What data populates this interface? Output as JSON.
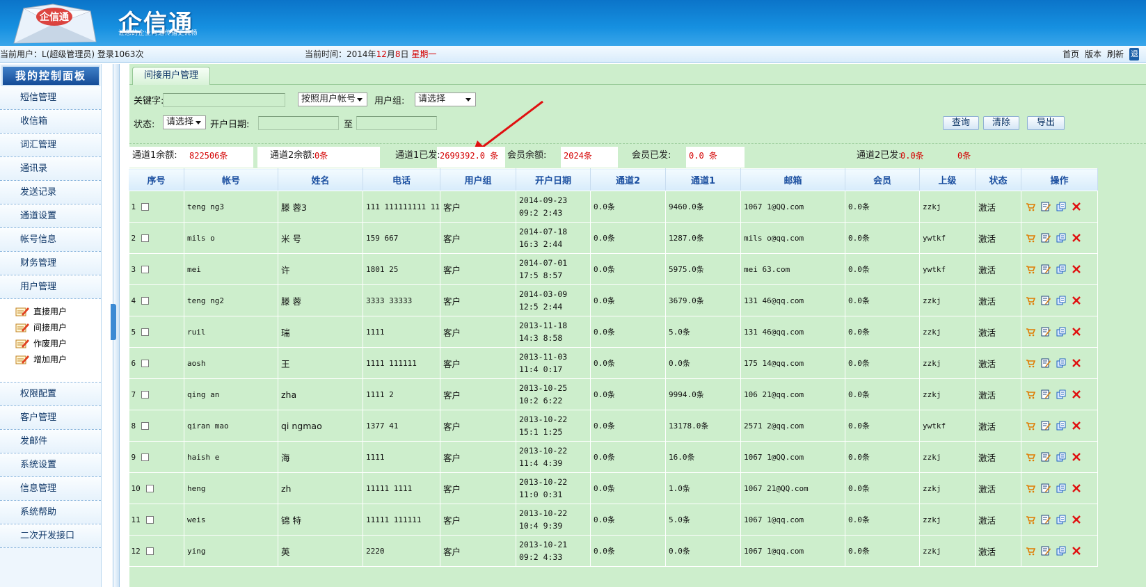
{
  "header": {
    "brand": "企信通",
    "slogan": "让您的企业沟通传播更流畅",
    "logo_text": "企信通"
  },
  "infobar": {
    "user_label": "当前用户：",
    "user_value": "L(超级管理员)",
    "login_text": "登录1063次",
    "time_label": "当前时间：",
    "time_year": "2014年",
    "time_month": "12",
    "time_month_suffix": "月",
    "time_day": "8",
    "time_day_suffix": "日",
    "weekday": "星期一",
    "links": [
      "首页",
      "版本",
      "刷新"
    ],
    "exit_label": "退"
  },
  "sidebar": {
    "title": "我的控制面板",
    "items_top": [
      "短信管理",
      "收信箱",
      "词汇管理",
      "通讯录",
      "发送记录",
      "通道设置",
      "帐号信息",
      "财务管理",
      "用户管理"
    ],
    "sub_items": [
      "直接用户",
      "间接用户",
      "作废用户",
      "增加用户"
    ],
    "items_bottom": [
      "权限配置",
      "客户管理",
      "发邮件",
      "系统设置",
      "信息管理",
      "系统帮助",
      "二次开发接口"
    ]
  },
  "main": {
    "tab": "间接用户管理",
    "search": {
      "keyword_label": "关键字:",
      "keyword_value": "",
      "by_select": "按照用户帐号",
      "group_label": "用户组:",
      "group_select": "请选择",
      "status_label": "状态:",
      "status_select": "请选择",
      "date_label": "开户日期:",
      "date_from": "",
      "to_label": "至",
      "date_to": "",
      "query_btn": "查询",
      "clear_btn": "清除",
      "export_btn": "导出"
    },
    "stats": {
      "ch1_balance_label": "通道1余额:",
      "ch1_balance": "822506条",
      "ch2_balance_label": "通道2余额:",
      "ch2_balance": "0条",
      "ch1_sent_label": "通道1已发:",
      "ch1_sent": "2699392.0 条",
      "member_balance_label": "会员余额:",
      "member_balance": "2024条",
      "member_sent_label": "会员已发:",
      "member_sent": "0.0 条",
      "ch2_sent_label": "通道2已发:",
      "ch2_sent": "0.0条",
      "extra": "0条"
    },
    "columns": [
      "序号",
      "帐号",
      "姓名",
      "电话",
      "用户组",
      "开户日期",
      "通道2",
      "通道1",
      "邮箱",
      "会员",
      "上级",
      "状态",
      "操作"
    ],
    "rows": [
      {
        "no": "1",
        "account": "teng    ng3",
        "name": "滕    蓉3",
        "phone": "111    111111111 11    ",
        "group": "客户",
        "date": "2014-09-23 09:2 2:43",
        "ch2": "0.0条",
        "ch1": "9460.0条",
        "email": "1067    1@QQ.com",
        "member": "0.0条",
        "parent": "zzkj",
        "status": "激活"
      },
      {
        "no": "2",
        "account": "mils    o",
        "name": "米    号",
        "phone": "159    667",
        "group": "客户",
        "date": "2014-07-18 16:3 2:44",
        "ch2": "0.0条",
        "ch1": "1287.0条",
        "email": "mils    o@qq.com",
        "member": "0.0条",
        "parent": "ywtkf",
        "status": "激活"
      },
      {
        "no": "3",
        "account": "mei",
        "name": "许",
        "phone": "1801    25",
        "group": "客户",
        "date": "2014-07-01 17:5 8:57",
        "ch2": "0.0条",
        "ch1": "5975.0条",
        "email": "mei    63.com",
        "member": "0.0条",
        "parent": "ywtkf",
        "status": "激活"
      },
      {
        "no": "4",
        "account": "teng    ng2",
        "name": "滕    蓉",
        "phone": "3333    33333",
        "group": "客户",
        "date": "2014-03-09 12:5 2:44",
        "ch2": "0.0条",
        "ch1": "3679.0条",
        "email": "131    46@qq.com",
        "member": "0.0条",
        "parent": "zzkj",
        "status": "激活"
      },
      {
        "no": "5",
        "account": "ruil",
        "name": "瑞",
        "phone": "1111",
        "group": "客户",
        "date": "2013-11-18 14:3 8:58",
        "ch2": "0.0条",
        "ch1": "5.0条",
        "email": "131    46@qq.com",
        "member": "0.0条",
        "parent": "zzkj",
        "status": "激活"
      },
      {
        "no": "6",
        "account": "aosh",
        "name": "王",
        "phone": "1111    111111",
        "group": "客户",
        "date": "2013-11-03 11:4 0:17",
        "ch2": "0.0条",
        "ch1": "0.0条",
        "email": "175    14@qq.com",
        "member": "0.0条",
        "parent": "zzkj",
        "status": "激活"
      },
      {
        "no": "7",
        "account": "qing    an",
        "name": "zha",
        "phone": "1111    2",
        "group": "客户",
        "date": "2013-10-25 10:2 6:22",
        "ch2": "0.0条",
        "ch1": "9994.0条",
        "email": "106    21@qq.com",
        "member": "0.0条",
        "parent": "zzkj",
        "status": "激活"
      },
      {
        "no": "8",
        "account": "qiran    mao",
        "name": "qi    ngmao",
        "phone": "1377    41",
        "group": "客户",
        "date": "2013-10-22 15:1 1:25",
        "ch2": "0.0条",
        "ch1": "13178.0条",
        "email": "2571    2@qq.com",
        "member": "0.0条",
        "parent": "ywtkf",
        "status": "激活"
      },
      {
        "no": "9",
        "account": "haish    e",
        "name": "海    ",
        "phone": "1111",
        "group": "客户",
        "date": "2013-10-22 11:4 4:39",
        "ch2": "0.0条",
        "ch1": "16.0条",
        "email": "1067    1@QQ.com",
        "member": "0.0条",
        "parent": "zzkj",
        "status": "激活"
      },
      {
        "no": "10",
        "account": "heng",
        "name": "zh",
        "phone": "11111    1111",
        "group": "客户",
        "date": "2013-10-22 11:0 0:31",
        "ch2": "0.0条",
        "ch1": "1.0条",
        "email": "1067    21@QQ.com",
        "member": "0.0条",
        "parent": "zzkj",
        "status": "激活"
      },
      {
        "no": "11",
        "account": "weis",
        "name": "锦    特",
        "phone": "11111    111111",
        "group": "客户",
        "date": "2013-10-22 10:4 9:39",
        "ch2": "0.0条",
        "ch1": "5.0条",
        "email": "1067    1@qq.com",
        "member": "0.0条",
        "parent": "zzkj",
        "status": "激活"
      },
      {
        "no": "12",
        "account": "ying",
        "name": "英",
        "phone": "2220",
        "group": "客户",
        "date": "2013-10-21 09:2 4:33",
        "ch2": "0.0条",
        "ch1": "0.0条",
        "email": "1067    1@qq.com",
        "member": "0.0条",
        "parent": "zzkj",
        "status": "激活"
      }
    ]
  },
  "colors": {
    "header": "#1690e0",
    "main_bg": "#cdeecc",
    "accent_red": "#d40000",
    "link_blue": "#1b4fa0"
  }
}
